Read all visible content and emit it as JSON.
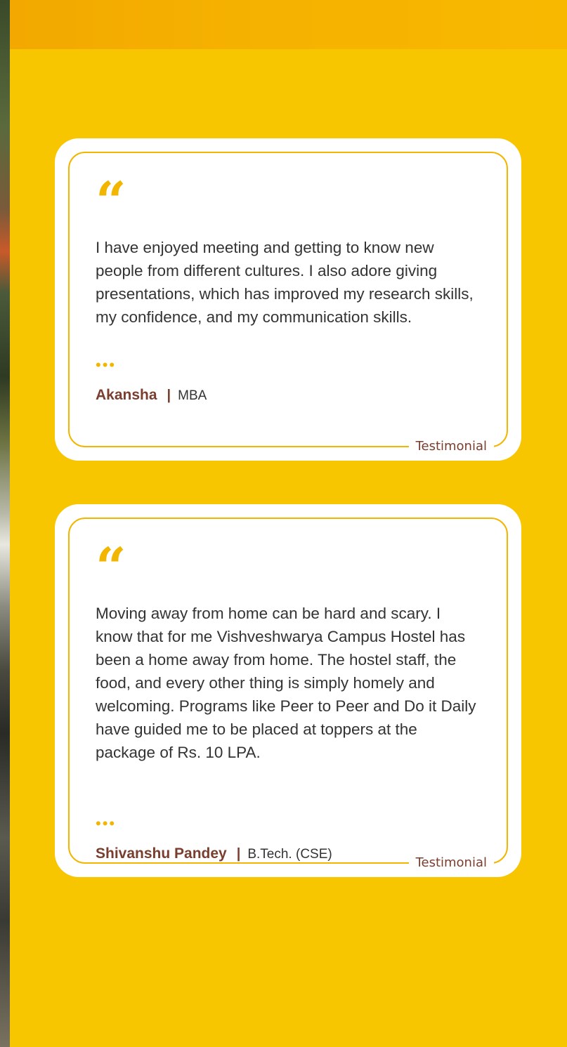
{
  "testimonials": [
    {
      "quote_mark": "“",
      "text": "I have enjoyed meeting and getting to know new people from different cultures. I also adore giving presentations, which has improved my research skills, my confidence, and my communication skills.",
      "dots": "•••",
      "name": "Akansha",
      "separator": "|",
      "program": "MBA",
      "tag": "Testimonial"
    },
    {
      "quote_mark": "“",
      "text": "Moving away from home can be hard and scary. I know that for me Vishveshwarya Campus Hostel has been a home away from home. The hostel staff, the food, and every other thing is simply homely and welcoming. Programs like Peer to Peer and Do it Daily have guided me to be placed at toppers at the package of Rs. 10 LPA.",
      "dots": "•••",
      "name": "Shivanshu Pandey",
      "separator": "|",
      "program": "B.Tech. (CSE)",
      "tag": "Testimonial"
    }
  ],
  "colors": {
    "background": "#f7c600",
    "accent": "#f2b600",
    "name": "#7a3e2e",
    "text": "#333333"
  }
}
